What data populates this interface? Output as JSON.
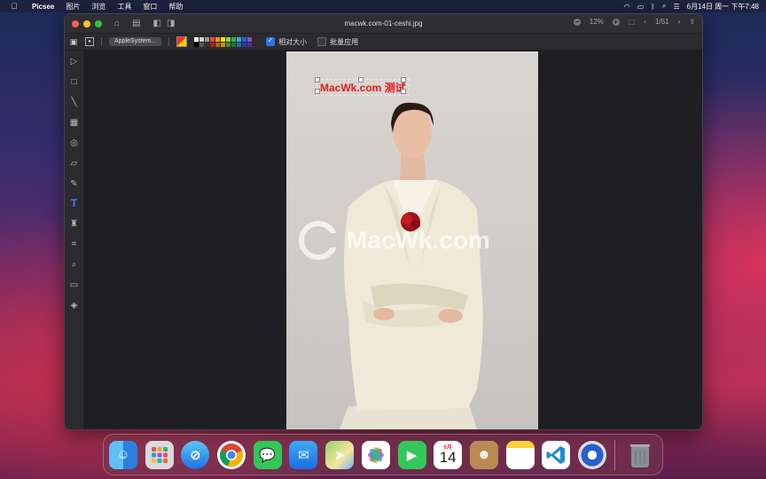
{
  "menubar": {
    "app_name": "Picsee",
    "menus": [
      "图片",
      "浏览",
      "工具",
      "窗口",
      "帮助"
    ],
    "clock": "6月14日 周一 下午7:48"
  },
  "window": {
    "title": "macwk.com-01-ceshi.jpg",
    "zoom_level": "12%",
    "page_counter": "1/51"
  },
  "options": {
    "font_name": "AppleSystem...",
    "palette_colors": [
      "#ffffff",
      "#cfcfcf",
      "#999999",
      "#ff4040",
      "#ff9a00",
      "#ffe600",
      "#8dd33a",
      "#27b64d",
      "#3aa7e8",
      "#2f5fe0",
      "#8a4be0",
      "#000000",
      "#555555",
      "#333333",
      "#b31d1d",
      "#b36200",
      "#b39a00",
      "#4d8a1f",
      "#17752f",
      "#1f6ea0",
      "#1f3ea0",
      "#5a2aa0"
    ],
    "relative_size_label": "相对大小",
    "relative_size_checked": true,
    "batch_apply_label": "批量应用",
    "batch_apply_checked": false
  },
  "canvas": {
    "annotation_text": "MacWk.com 测试",
    "watermark_text": "MacWk.com"
  },
  "tools": [
    "pointer-icon",
    "rectangle-icon",
    "line-icon",
    "grid-icon",
    "circle-icon",
    "eraser-icon",
    "pencil-icon",
    "text-icon",
    "stamp-icon",
    "crop-icon",
    "magnifier-icon",
    "frame-icon",
    "layers-icon"
  ],
  "dock": {
    "apps": [
      "finder",
      "launchpad",
      "safari",
      "chrome",
      "messages",
      "mail",
      "maps",
      "photos",
      "facetime",
      "calendar",
      "contacts",
      "notes",
      "vscode",
      "picsee",
      "trash"
    ],
    "calendar_month": "6月",
    "calendar_day": "14"
  }
}
